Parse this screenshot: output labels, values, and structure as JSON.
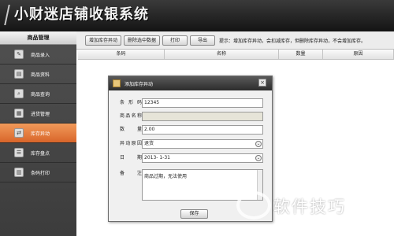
{
  "app": {
    "title": "小财迷店铺收银系统"
  },
  "sidebar": {
    "header": "商品管理",
    "items": [
      {
        "label": "商品录入",
        "icon": "product-entry-icon"
      },
      {
        "label": "商品资料",
        "icon": "product-info-icon"
      },
      {
        "label": "商品查询",
        "icon": "search-icon"
      },
      {
        "label": "进货管理",
        "icon": "purchase-icon"
      },
      {
        "label": "库存异动",
        "icon": "inventory-change-icon",
        "active": true
      },
      {
        "label": "库存盘点",
        "icon": "stocktake-icon"
      },
      {
        "label": "条码打印",
        "icon": "barcode-print-icon"
      }
    ]
  },
  "toolbar": {
    "buttons": [
      "增加库存异动",
      "删除选中数据",
      "打印",
      "导出"
    ],
    "tip": "提示：增加库存异动，会扣减库存，但删除库存异动，不会增加库存。"
  },
  "table": {
    "columns": [
      "条码",
      "名称",
      "数量",
      "原因"
    ]
  },
  "dialog": {
    "title": "添加库存异动",
    "fields": {
      "barcode": {
        "label": "条 形 码",
        "value": "12345"
      },
      "name": {
        "label": "商品名称",
        "value": ""
      },
      "quantity": {
        "label": "数　量",
        "value": "2.00"
      },
      "reason": {
        "label": "异动原因",
        "value": "退货"
      },
      "date": {
        "label": "日　期",
        "value": "2013-  1-31"
      },
      "note": {
        "label": "备　注",
        "value": "商品过期，无法使用"
      }
    },
    "save_label": "保存",
    "close_glyph": "×"
  },
  "watermark": "软件技巧",
  "colors": {
    "active_item": "#e27a3c",
    "header_bg": "#1f1f1f"
  }
}
